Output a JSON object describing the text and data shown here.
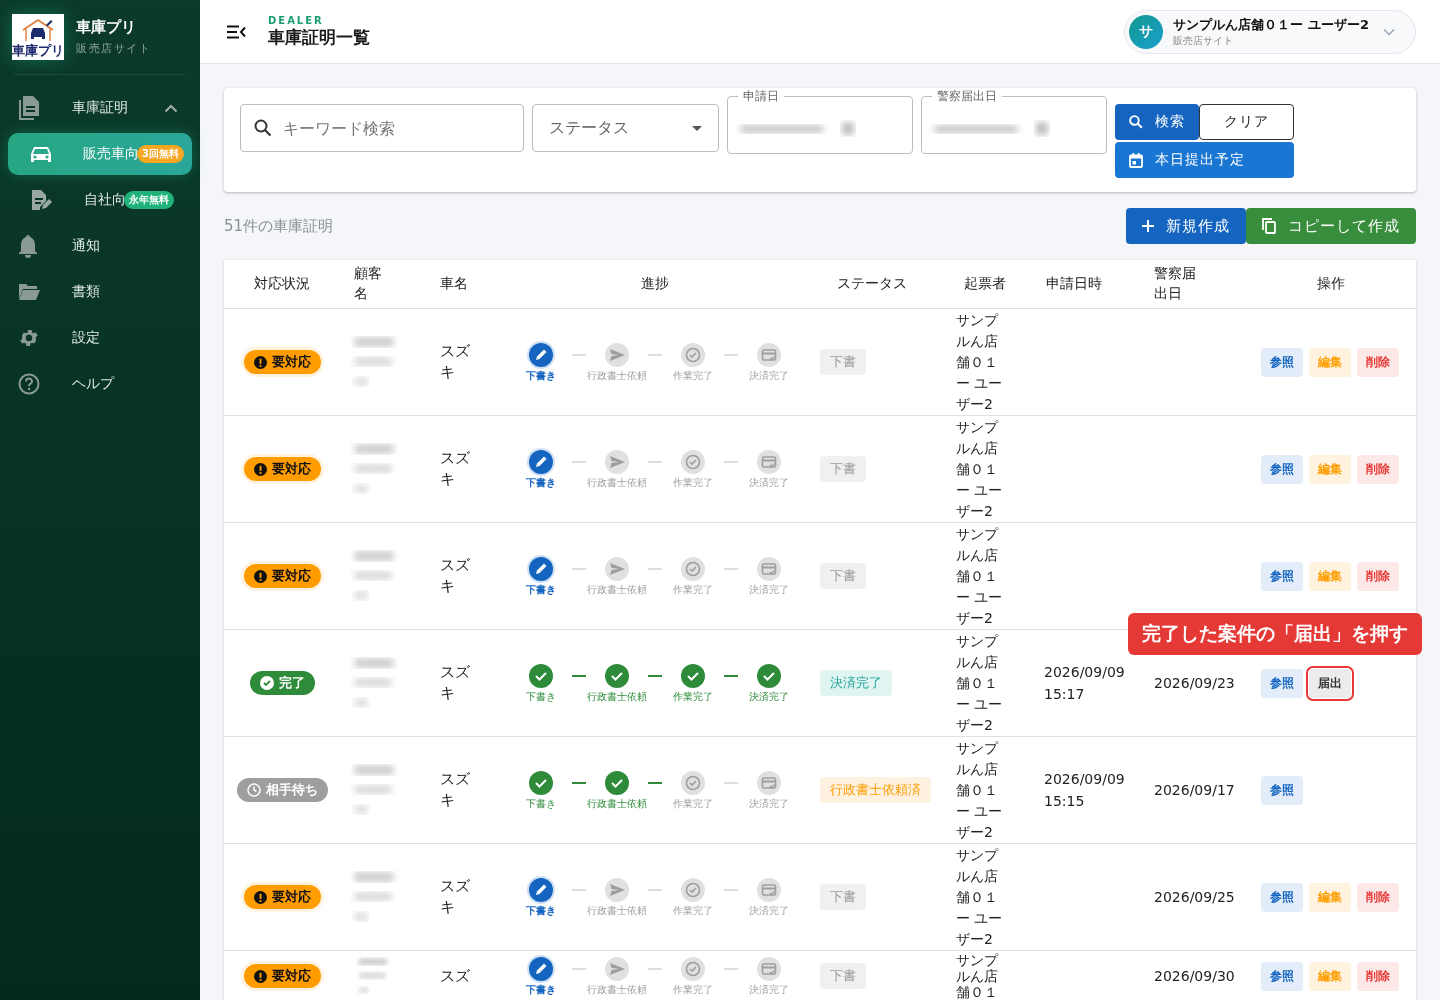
{
  "sidebar": {
    "logo_text": "車庫プリ",
    "app_name": "車庫プリ",
    "subtitle": "販売店サイト",
    "items": [
      {
        "label": "車庫証明",
        "kind": "document",
        "expanded": true,
        "selected": false,
        "children": [
          {
            "label": "販売車向",
            "kind": "car",
            "badge": "3回無料",
            "color": "#f5a623",
            "selected": true
          },
          {
            "label": "自社向",
            "kind": "edit-doc",
            "badge": "永年無料",
            "color": "#1fb37a",
            "selected": false
          }
        ]
      },
      {
        "label": "通知",
        "kind": "bell",
        "selected": false
      },
      {
        "label": "書類",
        "kind": "folder",
        "selected": false
      },
      {
        "label": "設定",
        "kind": "gear",
        "selected": false
      },
      {
        "label": "ヘルプ",
        "kind": "help",
        "selected": false
      }
    ]
  },
  "header": {
    "eyebrow": "DEALER",
    "title": "車庫証明一覧",
    "user": {
      "avatar": "サ",
      "name": "サンプルん店舗０１ー ユーザー2",
      "role": "販売店サイト"
    }
  },
  "filters": {
    "search_placeholder": "キーワード検索",
    "status_placeholder": "ステータス",
    "date_fields": [
      {
        "label": "申請日"
      },
      {
        "label": "警察届出日"
      }
    ],
    "search_button": "検索",
    "clear_button": "クリア",
    "today_button": "本日提出予定"
  },
  "count": "51件の車庫証明",
  "new_button": "新規作成",
  "copy_button": "コピーして作成",
  "table": {
    "columns": [
      "対応状況",
      "顧客名",
      "車名",
      "進捗",
      "ステータス",
      "起票者",
      "申請日時",
      "警察届出日",
      "操作"
    ],
    "rows": [
      {
        "response": {
          "label": "要対応",
          "kind": "action"
        },
        "car": "スズキ",
        "steps": [
          {
            "label": "下書き",
            "done": false,
            "current": true
          },
          {
            "label": "行政書士依頼",
            "done": false,
            "current": false
          },
          {
            "label": "作業完了",
            "done": false,
            "current": false
          },
          {
            "label": "決済完了",
            "done": false,
            "current": false
          }
        ],
        "status": {
          "label": "下書",
          "kind": "draft"
        },
        "creator": "サンプルん店舗０１ー ユーザー2",
        "actions": [
          {
            "label": "参照",
            "kind": "view",
            "highlighted": false
          },
          {
            "label": "編集",
            "kind": "edit",
            "highlighted": false
          },
          {
            "label": "削除",
            "kind": "delete",
            "highlighted": false
          }
        ]
      },
      {
        "response": {
          "label": "要対応",
          "kind": "action"
        },
        "car": "スズキ",
        "steps": [
          {
            "label": "下書き",
            "done": false,
            "current": true
          },
          {
            "label": "行政書士依頼",
            "done": false,
            "current": false
          },
          {
            "label": "作業完了",
            "done": false,
            "current": false
          },
          {
            "label": "決済完了",
            "done": false,
            "current": false
          }
        ],
        "status": {
          "label": "下書",
          "kind": "draft"
        },
        "creator": "サンプルん店舗０１ー ユーザー2",
        "actions": [
          {
            "label": "参照",
            "kind": "view",
            "highlighted": false
          },
          {
            "label": "編集",
            "kind": "edit",
            "highlighted": false
          },
          {
            "label": "削除",
            "kind": "delete",
            "highlighted": false
          }
        ]
      },
      {
        "response": {
          "label": "要対応",
          "kind": "action"
        },
        "car": "スズキ",
        "steps": [
          {
            "label": "下書き",
            "done": false,
            "current": true
          },
          {
            "label": "行政書士依頼",
            "done": false,
            "current": false
          },
          {
            "label": "作業完了",
            "done": false,
            "current": false
          },
          {
            "label": "決済完了",
            "done": false,
            "current": false
          }
        ],
        "status": {
          "label": "下書",
          "kind": "draft"
        },
        "creator": "サンプルん店舗０１ー ユーザー2",
        "actions": [
          {
            "label": "参照",
            "kind": "view",
            "highlighted": false
          },
          {
            "label": "編集",
            "kind": "edit",
            "highlighted": false
          },
          {
            "label": "削除",
            "kind": "delete",
            "highlighted": false
          }
        ]
      },
      {
        "response": {
          "label": "完了",
          "kind": "done"
        },
        "car": "スズキ",
        "steps": [
          {
            "label": "下書き",
            "done": true,
            "current": false
          },
          {
            "label": "行政書士依頼",
            "done": true,
            "current": false
          },
          {
            "label": "作業完了",
            "done": true,
            "current": false
          },
          {
            "label": "決済完了",
            "done": true,
            "current": false
          }
        ],
        "status": {
          "label": "決済完了",
          "kind": "settled"
        },
        "creator": "サンプルん店舗０１ー ユーザー2",
        "applied": "2026/09/09 15:17",
        "police_date": "2026/09/23",
        "actions": [
          {
            "label": "参照",
            "kind": "view",
            "highlighted": false
          },
          {
            "label": "届出",
            "kind": "file",
            "highlighted": true
          }
        ]
      },
      {
        "response": {
          "label": "相手待ち",
          "kind": "waiting"
        },
        "car": "スズキ",
        "steps": [
          {
            "label": "下書き",
            "done": true,
            "current": false
          },
          {
            "label": "行政書士依頼",
            "done": true,
            "current": false
          },
          {
            "label": "作業完了",
            "done": false,
            "current": false
          },
          {
            "label": "決済完了",
            "done": false,
            "current": false
          }
        ],
        "status": {
          "label": "行政書士依頼済",
          "kind": "requested"
        },
        "creator": "サンプルん店舗０１ー ユーザー2",
        "applied": "2026/09/09 15:15",
        "police_date": "2026/09/17",
        "actions": [
          {
            "label": "参照",
            "kind": "view",
            "highlighted": false
          }
        ]
      },
      {
        "response": {
          "label": "要対応",
          "kind": "action"
        },
        "car": "スズキ",
        "steps": [
          {
            "label": "下書き",
            "done": false,
            "current": true
          },
          {
            "label": "行政書士依頼",
            "done": false,
            "current": false
          },
          {
            "label": "作業完了",
            "done": false,
            "current": false
          },
          {
            "label": "決済完了",
            "done": false,
            "current": false
          }
        ],
        "status": {
          "label": "下書",
          "kind": "draft"
        },
        "creator": "サンプルん店舗０１ー ユーザー2",
        "police_date": "2026/09/25",
        "actions": [
          {
            "label": "参照",
            "kind": "view",
            "highlighted": false
          },
          {
            "label": "編集",
            "kind": "edit",
            "highlighted": false
          },
          {
            "label": "削除",
            "kind": "delete",
            "highlighted": false
          }
        ]
      },
      {
        "response": {
          "label": "要対応",
          "kind": "action"
        },
        "car": "スズ",
        "steps": [
          {
            "label": "下書き",
            "done": false,
            "current": true
          },
          {
            "label": "行政書士依頼",
            "done": false,
            "current": false
          },
          {
            "label": "作業完了",
            "done": false,
            "current": false
          },
          {
            "label": "決済完了",
            "done": false,
            "current": false
          }
        ],
        "status": {
          "label": "下書",
          "kind": "draft"
        },
        "creator": "サンプルん店舗０１",
        "police_date": "2026/09/30",
        "actions": [
          {
            "label": "参照",
            "kind": "view",
            "highlighted": false
          },
          {
            "label": "編集",
            "kind": "edit",
            "highlighted": false
          },
          {
            "label": "削除",
            "kind": "delete",
            "highlighted": false
          }
        ]
      }
    ]
  },
  "callout": "完了した案件の「届出」を押す"
}
